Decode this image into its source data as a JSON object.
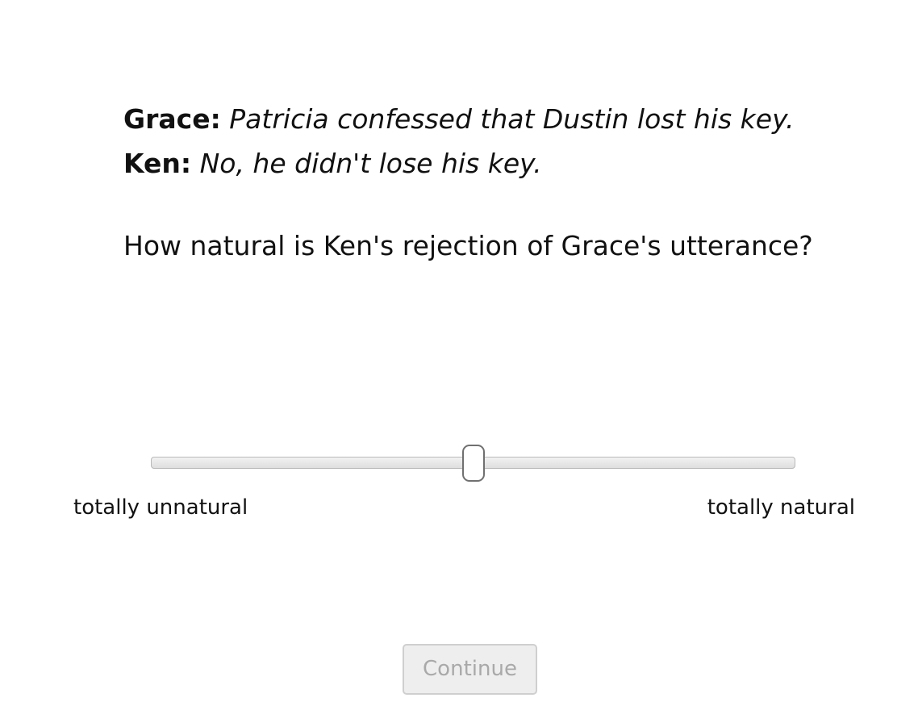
{
  "dialogue": [
    {
      "speaker": "Grace:",
      "utterance": "Patricia confessed that Dustin lost his key."
    },
    {
      "speaker": "Ken:",
      "utterance": "No, he didn't lose his key."
    }
  ],
  "question": "How natural is Ken's rejection of Grace's utterance?",
  "slider": {
    "value": 0.5,
    "min_label": "totally unnatural",
    "max_label": "totally natural"
  },
  "continue_button": {
    "label": "Continue",
    "disabled": true
  }
}
